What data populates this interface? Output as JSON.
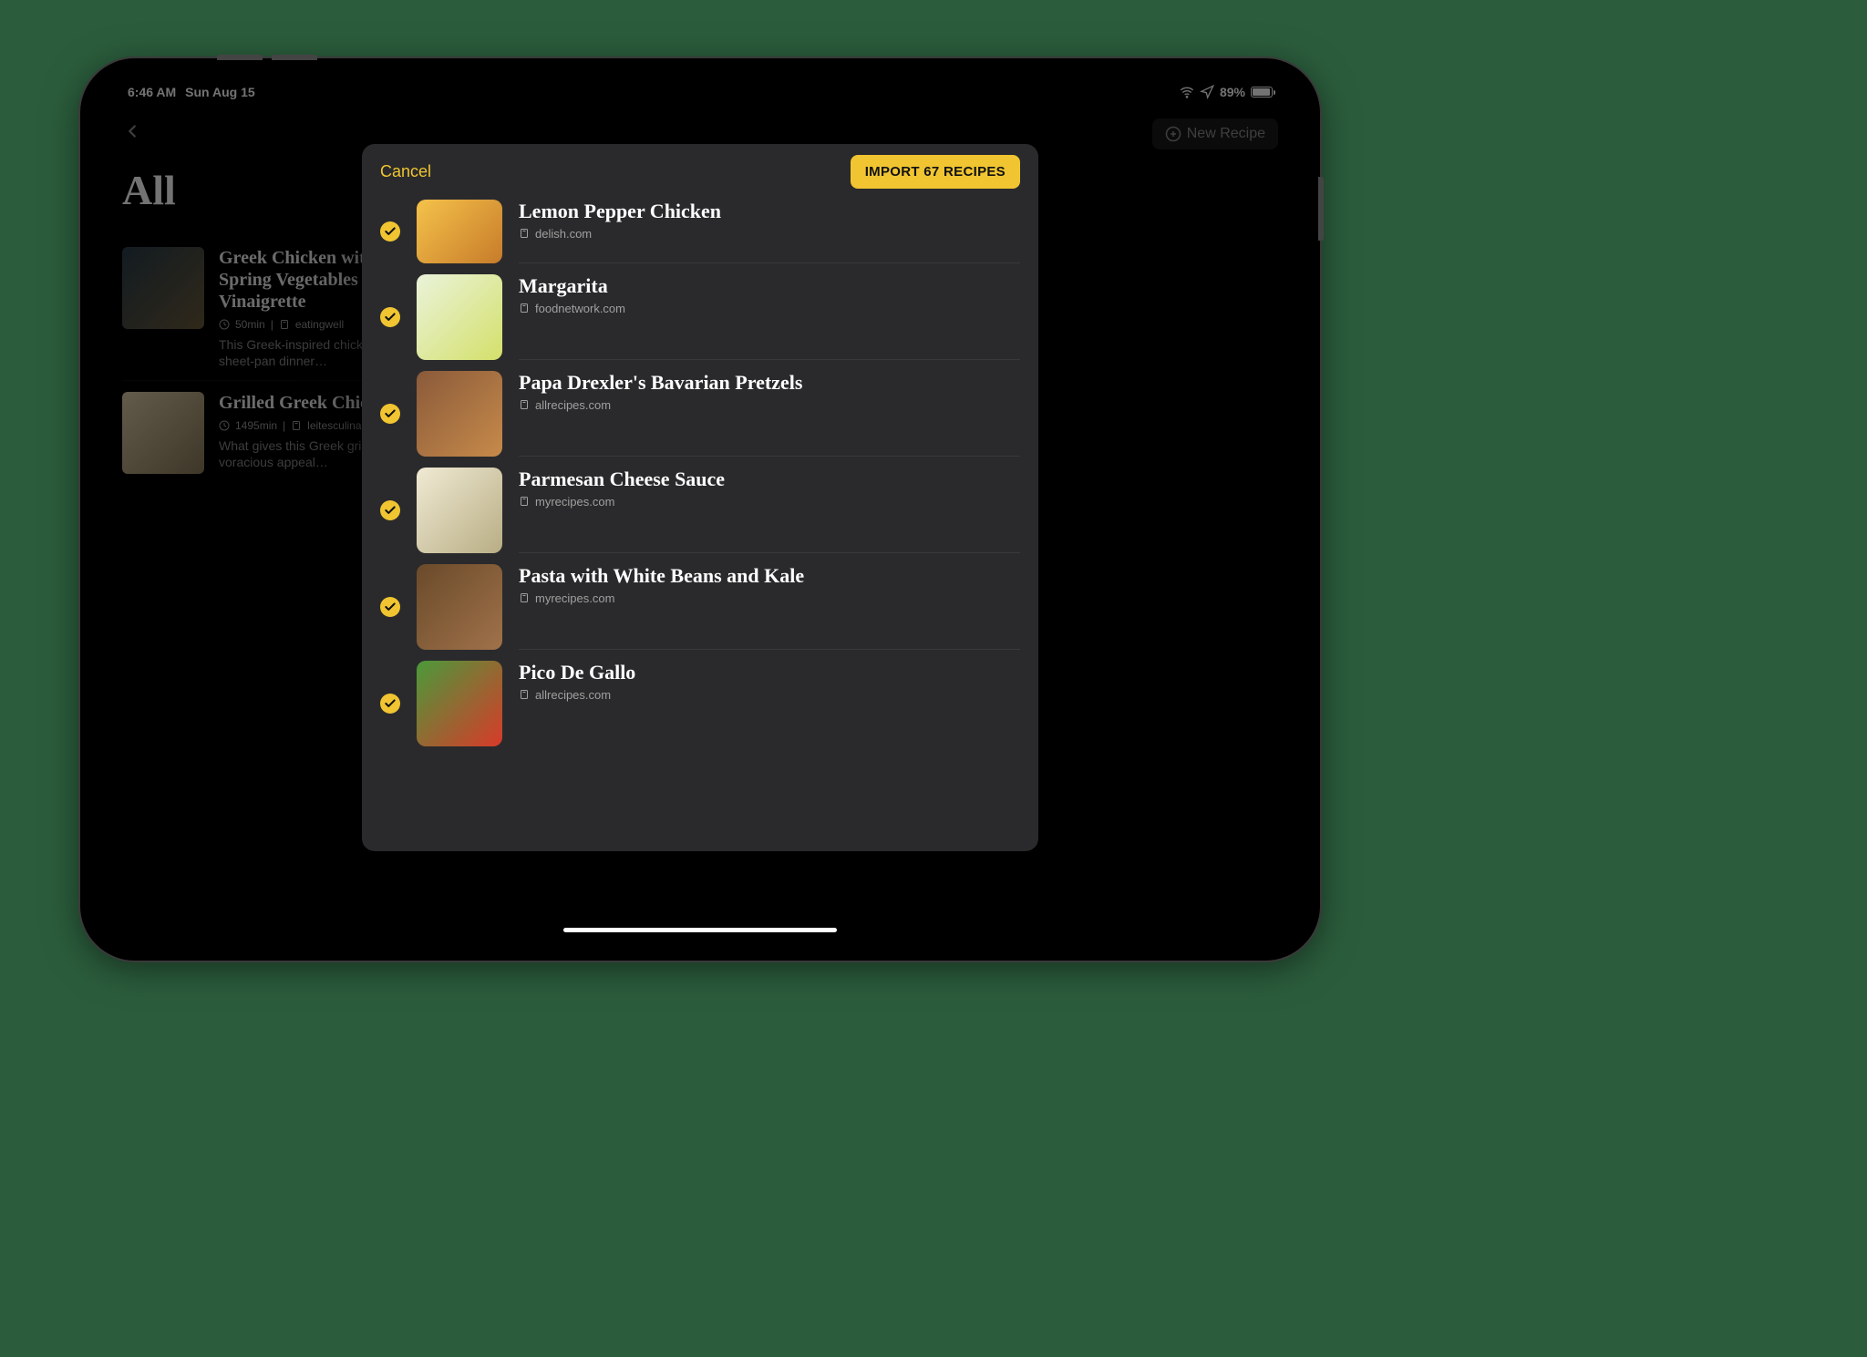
{
  "status": {
    "time": "6:46 AM",
    "date": "Sun Aug 15",
    "battery": "89%"
  },
  "app": {
    "title": "All",
    "new_recipe": "New Recipe"
  },
  "bgRecipes": [
    {
      "title": "Greek Chicken with Roasted Spring Vegetables & Lemon Vinaigrette",
      "time": "50min",
      "source": "eatingwell",
      "desc": "This Greek-inspired chicken and vegetable sheet-pan dinner…"
    },
    {
      "title": "Grilled Greek Chicken",
      "time": "1495min",
      "source": "leitesculinaria",
      "desc": "What gives this Greek grilled chicken its voracious appeal…"
    }
  ],
  "modal": {
    "cancel": "Cancel",
    "import": "IMPORT 67 RECIPES",
    "items": [
      {
        "title": "Lemon Pepper Chicken",
        "source": "delish.com"
      },
      {
        "title": "Margarita",
        "source": "foodnetwork.com"
      },
      {
        "title": "Papa Drexler's Bavarian Pretzels",
        "source": "allrecipes.com"
      },
      {
        "title": "Parmesan Cheese Sauce",
        "source": "myrecipes.com"
      },
      {
        "title": "Pasta with White Beans and Kale",
        "source": "myrecipes.com"
      },
      {
        "title": "Pico De Gallo",
        "source": "allrecipes.com"
      }
    ]
  }
}
